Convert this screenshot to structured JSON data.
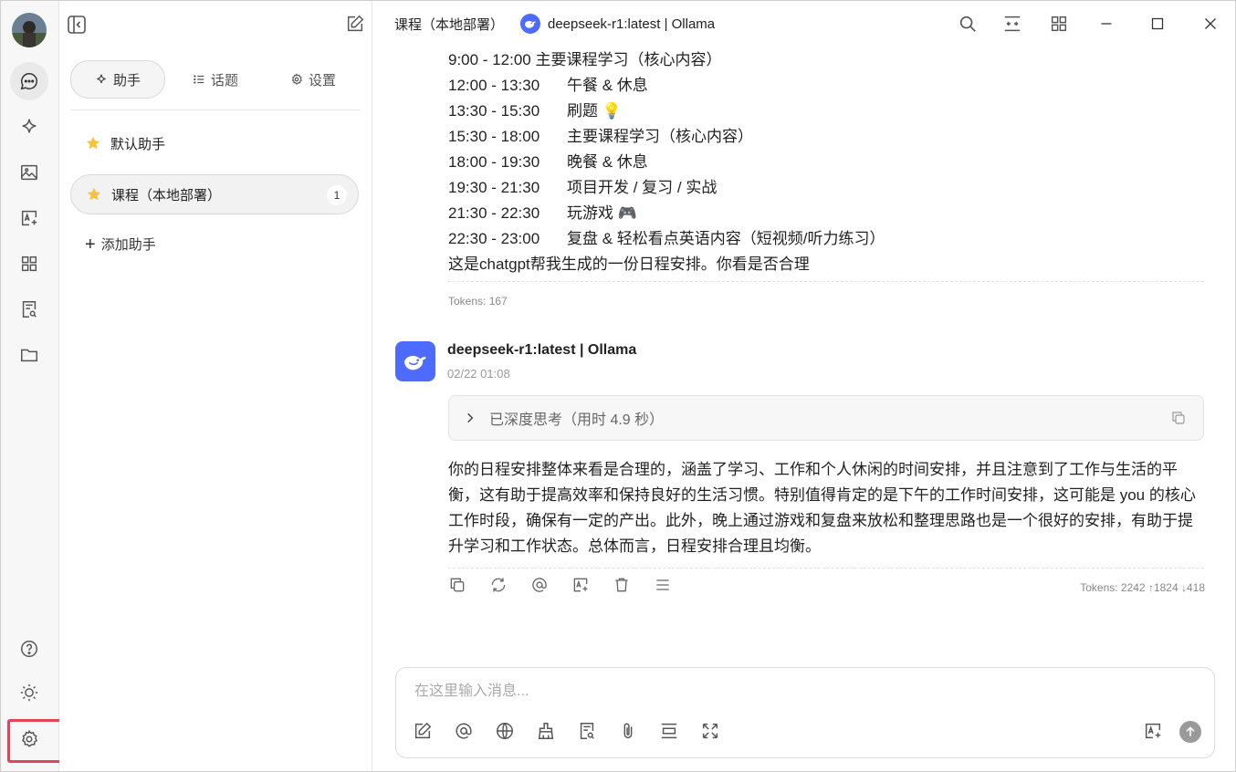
{
  "sidebar": {
    "nav": [
      "chat-icon",
      "sparkle-icon",
      "image-icon",
      "translate-icon",
      "apps-icon",
      "knowledge-icon",
      "folder-icon"
    ],
    "bottom": [
      "help-icon",
      "theme-icon",
      "settings-icon"
    ]
  },
  "panel": {
    "tabs": [
      {
        "label": "助手",
        "icon": "sparkle-icon"
      },
      {
        "label": "话题",
        "icon": "list-icon"
      },
      {
        "label": "设置",
        "icon": "gear-icon"
      }
    ],
    "assistants": [
      {
        "name": "默认助手",
        "badge": ""
      },
      {
        "name": "课程（本地部署）",
        "badge": "1"
      }
    ],
    "add_label": "添加助手"
  },
  "header": {
    "assistant_title": "课程（本地部署）",
    "model": "deepseek-r1:latest | Ollama"
  },
  "user_message": {
    "schedule": [
      {
        "time": "9:00 - 12:00",
        "task": "主要课程学习（核心内容）"
      },
      {
        "time": "12:00 - 13:30",
        "task": "午餐 & 休息"
      },
      {
        "time": "13:30 - 15:30",
        "task": "刷题 💡"
      },
      {
        "time": "15:30 - 18:00",
        "task": "主要课程学习（核心内容）"
      },
      {
        "time": "18:00 - 19:30",
        "task": "晚餐 & 休息"
      },
      {
        "time": "19:30 - 21:30",
        "task": "项目开发 / 复习 / 实战"
      },
      {
        "time": "21:30 - 22:30",
        "task": "玩游戏 🎮"
      },
      {
        "time": "22:30 - 23:00",
        "task": "复盘 & 轻松看点英语内容（短视频/听力练习）"
      }
    ],
    "question": "这是chatgpt帮我生成的一份日程安排。你看是否合理",
    "tokens": "Tokens: 167"
  },
  "bot_message": {
    "name": "deepseek-r1:latest | Ollama",
    "time": "02/22 01:08",
    "thinking_label": "已深度思考（用时 4.9 秒）",
    "content": "你的日程安排整体来看是合理的，涵盖了学习、工作和个人休闲的时间安排，并且注意到了工作与生活的平衡，这有助于提高效率和保持良好的生活习惯。特别值得肯定的是下午的工作时间安排，这可能是 you 的核心工作时段，确保有一定的产出。此外，晚上通过游戏和复盘来放松和整理思路也是一个很好的安排，有助于提升学习和工作状态。总体而言，日程安排合理且均衡。",
    "tokens": "Tokens: 2242 ↑1824 ↓418"
  },
  "input": {
    "placeholder": "在这里输入消息...",
    "value": ""
  },
  "colors": {
    "accent": "#4d6bfe",
    "highlight": "#e0455b",
    "star": "#f5c33b"
  }
}
